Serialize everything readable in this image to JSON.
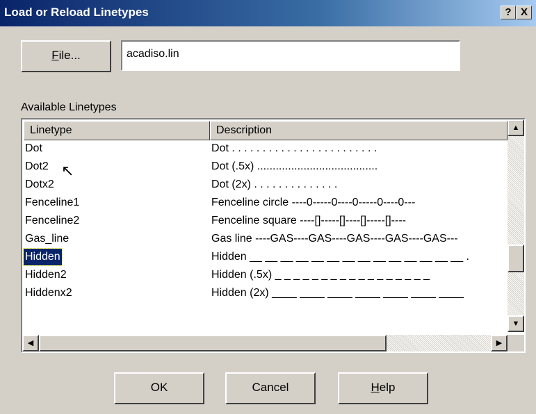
{
  "window": {
    "title": "Load or Reload Linetypes",
    "help_button": "?",
    "close_button": "X"
  },
  "file": {
    "button_label": "File...",
    "button_mnemonic": "F",
    "button_rest": "ile...",
    "path_value": "acadiso.lin"
  },
  "available_label": "Available Linetypes",
  "list": {
    "headers": [
      "Linetype",
      "Description"
    ],
    "rows": [
      {
        "name": "Dot",
        "desc": "Dot . . . . . . . . . . . . . . . . . . . . . . . ."
      },
      {
        "name": "Dot2",
        "desc": "Dot (.5x) ......................................."
      },
      {
        "name": "Dotx2",
        "desc": "Dot (2x) .  .  .  .  .  .  .  .  .  .  .  .  .  ."
      },
      {
        "name": "Fenceline1",
        "desc": "Fenceline circle ----0-----0----0-----0----0---"
      },
      {
        "name": "Fenceline2",
        "desc": "Fenceline square ----[]-----[]----[]-----[]----"
      },
      {
        "name": "Gas_line",
        "desc": "Gas line ----GAS----GAS----GAS----GAS----GAS---"
      },
      {
        "name": "Hidden",
        "desc": "Hidden __ __ __ __ __ __ __ __ __ __ __ __ __ __ ."
      },
      {
        "name": "Hidden2",
        "desc": "Hidden (.5x) _ _ _ _ _ _ _ _ _ _ _ _ _ _ _ _ _"
      },
      {
        "name": "Hiddenx2",
        "desc": "Hidden (2x) ____ ____ ____ ____ ____ ____ ____"
      }
    ],
    "selected": "Hidden"
  },
  "buttons": {
    "ok": "OK",
    "cancel": "Cancel",
    "help_mnemonic": "H",
    "help_rest": "elp"
  },
  "icons": {
    "scroll_up": "▲",
    "scroll_down": "▼",
    "scroll_left": "◀",
    "scroll_right": "▶",
    "cursor": "↖"
  }
}
